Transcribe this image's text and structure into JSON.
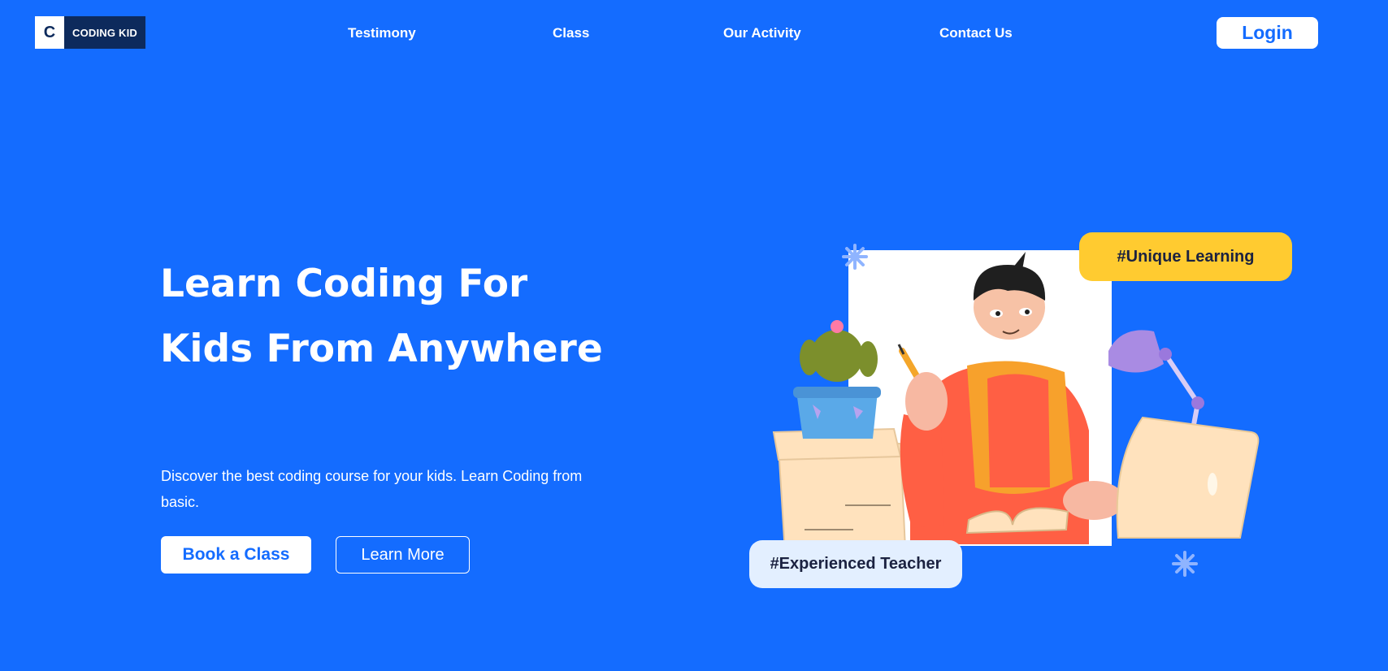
{
  "header": {
    "logo_letter": "C",
    "logo_text": "CODING KID",
    "nav": [
      "Testimony",
      "Class",
      "Our Activity",
      "Contact Us"
    ],
    "login_label": "Login"
  },
  "hero": {
    "title": "Learn Coding For Kids From Anywhere",
    "subtitle": "Discover the best coding course for your kids. Learn Coding from basic.",
    "primary_button": "Book a Class",
    "secondary_button": "Learn More"
  },
  "illustration": {
    "badge_top": "#Unique Learning",
    "badge_bottom": "#Experienced Teacher"
  },
  "colors": {
    "background": "#146cff",
    "logo_dark": "#0d2a5c",
    "badge_yellow": "#ffcb30",
    "badge_light": "#e3efff"
  }
}
